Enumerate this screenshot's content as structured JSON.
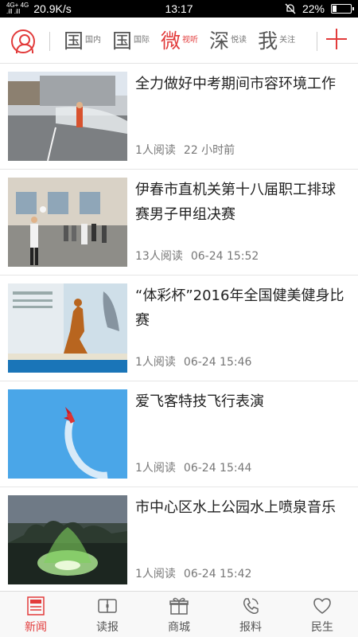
{
  "status_bar": {
    "signal": "4G+ 4G\n.ill .ill",
    "speed": "20.9K/s",
    "time": "13:17",
    "battery_text": "22%",
    "battery_level": 0.22
  },
  "channels": [
    {
      "big": "国",
      "small": "国内",
      "active": false
    },
    {
      "big": "国",
      "small": "国际",
      "active": false
    },
    {
      "big": "微",
      "small": "视听",
      "active": true
    },
    {
      "big": "深",
      "small": "悦读",
      "active": false
    },
    {
      "big": "我",
      "small": "关注",
      "active": false
    }
  ],
  "news": [
    {
      "title": "全力做好中考期间市容环境工作",
      "reads": "1人阅读",
      "time": "22 小时前"
    },
    {
      "title": "伊春市直机关第十八届职工排球赛男子甲组决赛",
      "reads": "13人阅读",
      "time": "06-24 15:52"
    },
    {
      "title": "“体彩杯”2016年全国健美健身比赛",
      "reads": "1人阅读",
      "time": "06-24 15:46"
    },
    {
      "title": "爱飞客特技飞行表演",
      "reads": "1人阅读",
      "time": "06-24 15:44"
    },
    {
      "title": "市中心区水上公园水上喷泉音乐",
      "reads": "1人阅读",
      "time": "06-24 15:42"
    }
  ],
  "bottom_nav": [
    {
      "label": "新闻",
      "icon": "news-icon",
      "active": true
    },
    {
      "label": "读报",
      "icon": "newspaper-icon",
      "active": false
    },
    {
      "label": "商城",
      "icon": "gift-icon",
      "active": false
    },
    {
      "label": "报料",
      "icon": "phone-icon",
      "active": false
    },
    {
      "label": "民生",
      "icon": "heart-icon",
      "active": false
    }
  ],
  "colors": {
    "accent": "#e23b3b",
    "text": "#222222",
    "meta": "#777777"
  }
}
